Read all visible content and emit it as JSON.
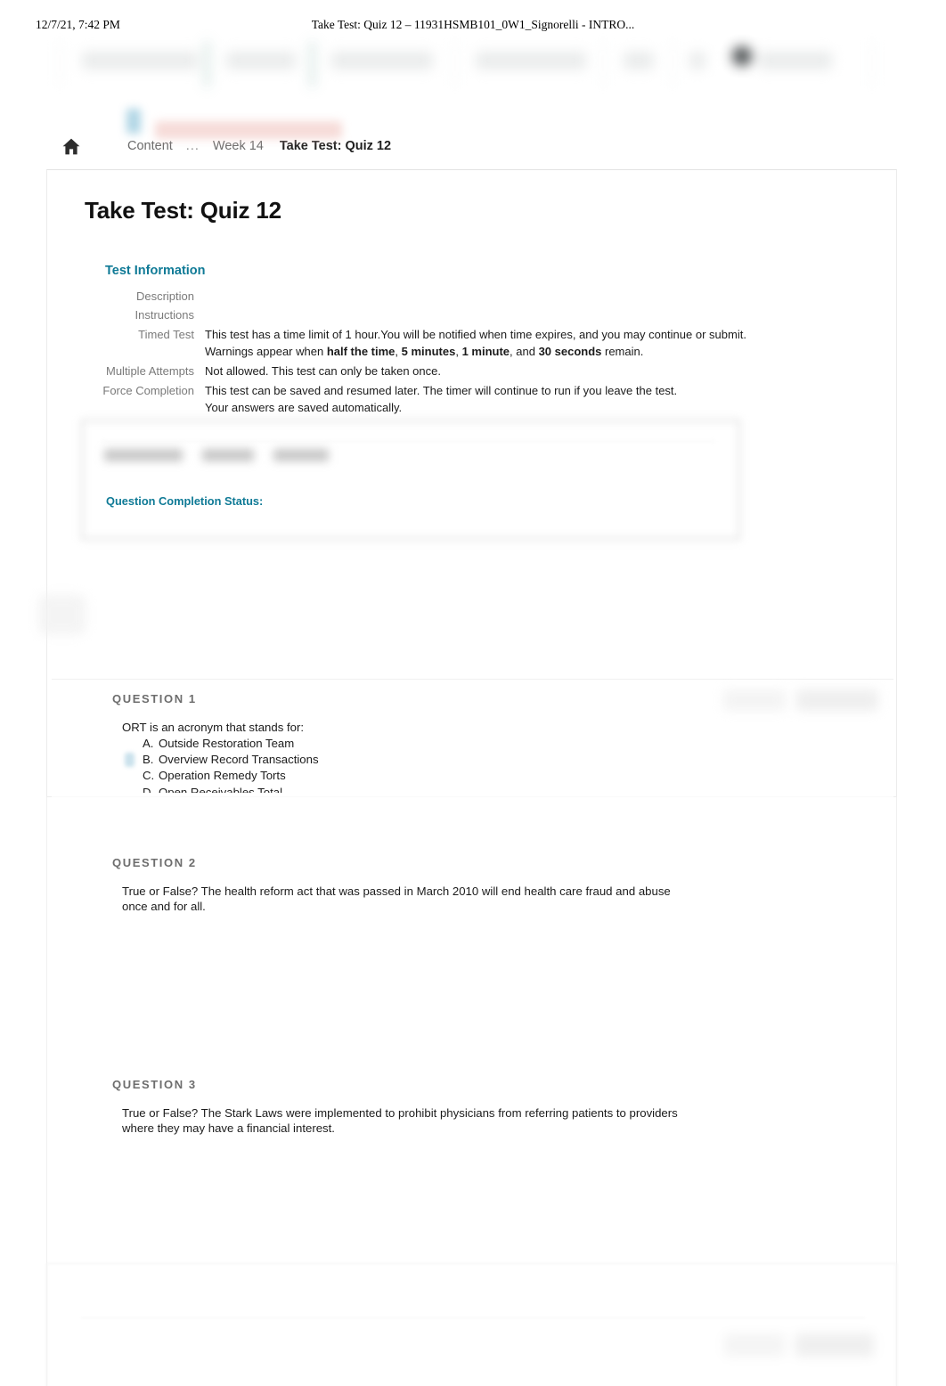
{
  "print_header": {
    "datetime": "12/7/21, 7:42 PM",
    "document_title": "Take Test: Quiz 12 – 11931HSMB101_0W1_Signorelli - INTRO..."
  },
  "breadcrumb": {
    "home_icon": "home-icon",
    "items": [
      {
        "label": "Content",
        "current": false
      },
      {
        "label": "...",
        "current": false
      },
      {
        "label": "Week 14",
        "current": false
      },
      {
        "label": "Take Test: Quiz 12",
        "current": true
      }
    ]
  },
  "page": {
    "title": "Take Test: Quiz 12"
  },
  "test_information": {
    "heading": "Test Information",
    "rows": [
      {
        "label": "Description",
        "value": ""
      },
      {
        "label": "Instructions",
        "value": ""
      },
      {
        "label": "Timed Test",
        "value_line1": "This test has a time limit of 1 hour.You will be notified when time expires, and you may continue or submit.",
        "value_line2_prefix": "Warnings appear when ",
        "value_bold_1": "half the time",
        "value_mid_1": ", ",
        "value_bold_2": "5 minutes",
        "value_mid_2": ", ",
        "value_bold_3": "1 minute",
        "value_mid_3": ", and ",
        "value_bold_4": "30 seconds",
        "value_suffix": " remain."
      },
      {
        "label": "Multiple Attempts",
        "value": "Not allowed. This test can only be taken once."
      },
      {
        "label": "Force Completion",
        "value_line1": "This test can be saved and resumed later. The timer will continue to run if you leave the test.",
        "value_line2": "Your answers are saved automatically."
      }
    ]
  },
  "control_box": {
    "question_completion_status_label": "Question Completion Status:"
  },
  "questions": [
    {
      "header": "QUESTION 1",
      "text": "ORT is an acronym that stands for:",
      "options": [
        {
          "letter": "A.",
          "label": "Outside Restoration Team",
          "selected": false
        },
        {
          "letter": "B.",
          "label": "Overview Record Transactions",
          "selected": true
        },
        {
          "letter": "C.",
          "label": "Operation Remedy Torts",
          "selected": false
        },
        {
          "letter": "D.",
          "label": "Open Receivables Total",
          "selected": false
        }
      ]
    },
    {
      "header": "QUESTION 2",
      "text": "True or False? The health reform act that was passed in March 2010 will end health care fraud and abuse once and for all.",
      "options": []
    },
    {
      "header": "QUESTION 3",
      "text": "True or False? The Stark Laws were implemented to prohibit physicians from referring patients to providers where they may have a financial interest.",
      "options": []
    }
  ],
  "colors": {
    "accent_teal": "#0f7a96",
    "body_text": "#1b1b1b",
    "muted_label": "#7a7a7a",
    "question_header": "#6d6d6d",
    "selected_marker": "#b9d8e6",
    "page_background": "#ffffff"
  }
}
